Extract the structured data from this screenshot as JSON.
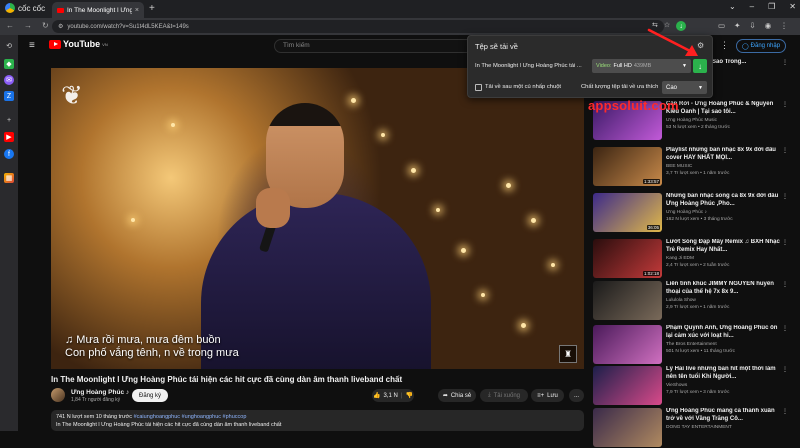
{
  "browser": {
    "brand": "cốc cốc",
    "tab_title": "In The Moonlight l Ưng Hoàng Phúc t",
    "tab_close": "×",
    "new_tab": "+",
    "url": "youtube.com/watch?v=Su1t4dL5KEA&t=149s",
    "window_controls": [
      "⌄",
      "–",
      "❐",
      "✕"
    ]
  },
  "youtube": {
    "logo_text": "YouTube",
    "logo_country": "VN",
    "search_placeholder": "Tìm kiếm",
    "signin_label": "Đăng nhập",
    "more_icon": "⋮"
  },
  "video": {
    "lyrics_line1": "♫ Mưa rồi mưa, mưa    đêm buồn",
    "lyrics_line2": "Con phố vắng tênh, n       về trong mưa",
    "title": "In The Moonlight l Ưng Hoàng Phúc tái hiện các hit cực đã cùng dàn âm thanh liveband chất",
    "channel": "Ưng Hoàng Phúc ♪",
    "subscribers": "1,84 Tr người đăng ký",
    "subscribe_label": "Đăng ký",
    "likes": "3,1 N",
    "share_label": "Chia sẻ",
    "download_label": "Tải xuống",
    "save_label": "Lưu",
    "more_label": "...",
    "desc_views": "741 N lượt xem  10 tháng trước",
    "desc_tags": "#caiunghoangphuc #unghoangphuc #phuccop",
    "desc_line2": "In The Moonlight l Ưng Hoàng Phúc tái hiện các hit cực đã cùng dàn âm thanh liveband chất"
  },
  "download_popup": {
    "title": "Tệp sẽ tải về",
    "filename": "In The Moonlight l Ưng Hoàng Phúc tái ...",
    "quality_type": "Video:",
    "quality_value": "Full HD",
    "quality_size": "439MB",
    "auto_download_label": "Tải về sau một cú nhấp chuột",
    "pref_label": "Chất lượng tệp tải về ưa thích",
    "pref_value": "Cao"
  },
  "watermark": "appsoluit.com",
  "related": [
    {
      "title": "...IC Live 10 HIT Sao Trong...",
      "channel": "",
      "meta": "",
      "duration": "",
      "colors": [
        "#2a2a2a",
        "#2a2a2a"
      ]
    },
    {
      "title": "Cần Rời - Ưng Hoàng Phúc & Nguyễn Kiều Oanh | Tại sao tôi...",
      "channel": "Ưng Hoàng Phúc Music",
      "meta": "53 N lượt xem • 2 tháng trước",
      "duration": "",
      "colors": [
        "#3a1a66",
        "#c25ad8"
      ]
    },
    {
      "title": "Playlist những bản nhạc 8x 9x đời đầu cover HAY NHẤT MỌI...",
      "channel": "BEE MUSIC",
      "meta": "3,7 Tr lượt xem • 1 năm trước",
      "duration": "1:33:57",
      "colors": [
        "#3b2412",
        "#c88a4a"
      ]
    },
    {
      "title": "Những bản nhạc song ca 8x 9x đời đầu Ưng Hoàng Phúc ,Pho...",
      "channel": "Ưng Hoàng Phúc ♪",
      "meta": "162 N lượt xem • 3 tháng trước",
      "duration": "36:05",
      "colors": [
        "#3c2a8a",
        "#e0b84a"
      ]
    },
    {
      "title": "Lướt Sóng Đạp Mây Remix ♫ BXH Nhạc Trẻ Remix Hay Nhất...",
      "channel": "Kang Ji EDM",
      "meta": "2,4 Tr lượt xem • 2 tuần trước",
      "duration": "1:02:18",
      "colors": [
        "#2a0d0d",
        "#c33a3a"
      ]
    },
    {
      "title": "Liên tính khúc JIMMY NGUYỄN huyền thoại của thế hệ 7x 8x 9...",
      "channel": "Lululola Show",
      "meta": "2,9 Tr lượt xem • 1 năm trước",
      "duration": "",
      "colors": [
        "#1a1a1a",
        "#7a6a5a"
      ]
    },
    {
      "title": "Phạm Quỳnh Anh, Ưng Hoàng Phúc ôn lại cảm xúc với loạt hi...",
      "channel": "The Bros Entertainment",
      "meta": "501 N lượt xem • 11 tháng trước",
      "duration": "",
      "colors": [
        "#4a1a5a",
        "#d070c0"
      ]
    },
    {
      "title": "Lý Hải live những bản hit một thời làm nên tên tuổi Khi Người...",
      "channel": "VieShows",
      "meta": "7,9 Tr lượt xem • 3 năm trước",
      "duration": "",
      "colors": [
        "#1c1f4a",
        "#d94a8a"
      ]
    },
    {
      "title": "Ưng Hoàng Phúc mang cả thanh xuân trở về với Vầng Trăng Cô...",
      "channel": "DONG TAY ENTERTAINMENT",
      "meta": "",
      "duration": "",
      "colors": [
        "#3a2a4a",
        "#b08a60"
      ]
    }
  ]
}
